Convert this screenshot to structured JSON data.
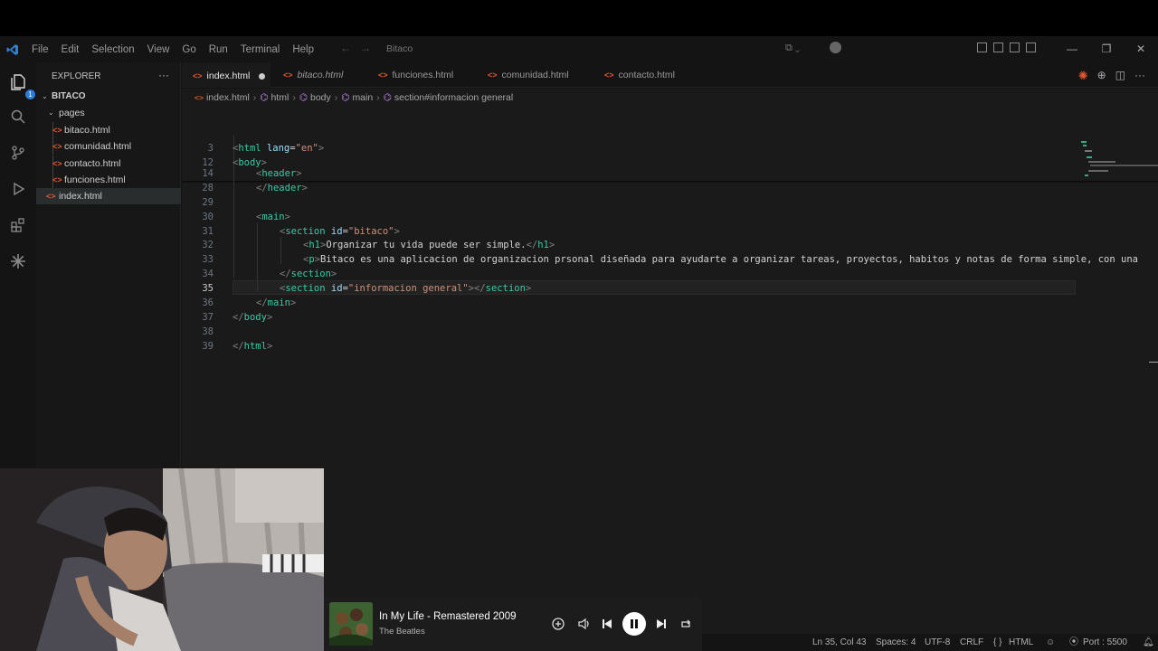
{
  "menu": [
    "File",
    "Edit",
    "Selection",
    "View",
    "Go",
    "Run",
    "Terminal",
    "Help"
  ],
  "command_center": "Bitaco",
  "explorer": {
    "title": "EXPLORER",
    "root": "BITACO",
    "folder": "pages",
    "files_in_pages": [
      "bitaco.html",
      "comunidad.html",
      "contacto.html",
      "funciones.html"
    ],
    "root_file": "index.html"
  },
  "source_control_badge": "1",
  "tabs": [
    {
      "label": "index.html",
      "active": true,
      "modified": true
    },
    {
      "label": "bitaco.html",
      "italic": true
    },
    {
      "label": "funciones.html"
    },
    {
      "label": "comunidad.html"
    },
    {
      "label": "contacto.html"
    }
  ],
  "breadcrumb": [
    "index.html",
    "html",
    "body",
    "main",
    "section#informacion general"
  ],
  "code_lines": [
    {
      "n": "3",
      "text": "<html lang=\"en\">"
    },
    {
      "n": "12",
      "text": "<body>"
    },
    {
      "n": "14",
      "text": "<header>"
    },
    {
      "n": "28",
      "text": "</header>"
    },
    {
      "n": "29",
      "text": ""
    },
    {
      "n": "30",
      "text": "<main>"
    },
    {
      "n": "31",
      "text": "<section id=\"bitaco\">"
    },
    {
      "n": "32",
      "text": "<h1>Organizar tu vida puede ser simple.</h1>"
    },
    {
      "n": "33",
      "text": "<p>Bitaco es una aplicacion de organizacion prsonal diseñada para ayudarte a organizar tareas, proyectos, habitos y notas de forma simple, con una"
    },
    {
      "n": "34",
      "text": "</section>"
    },
    {
      "n": "35",
      "text": "<section id=\"informacion general\"></section>"
    },
    {
      "n": "36",
      "text": "</main>"
    },
    {
      "n": "37",
      "text": "</body>"
    },
    {
      "n": "38",
      "text": ""
    },
    {
      "n": "39",
      "text": "</html>"
    }
  ],
  "status": {
    "position": "Ln 35, Col 43",
    "spaces": "Spaces: 4",
    "encoding": "UTF-8",
    "eol": "CRLF",
    "language": "HTML",
    "port": "Port : 5500"
  },
  "player": {
    "title": "In My Life - Remastered 2009",
    "artist": "The Beatles"
  }
}
